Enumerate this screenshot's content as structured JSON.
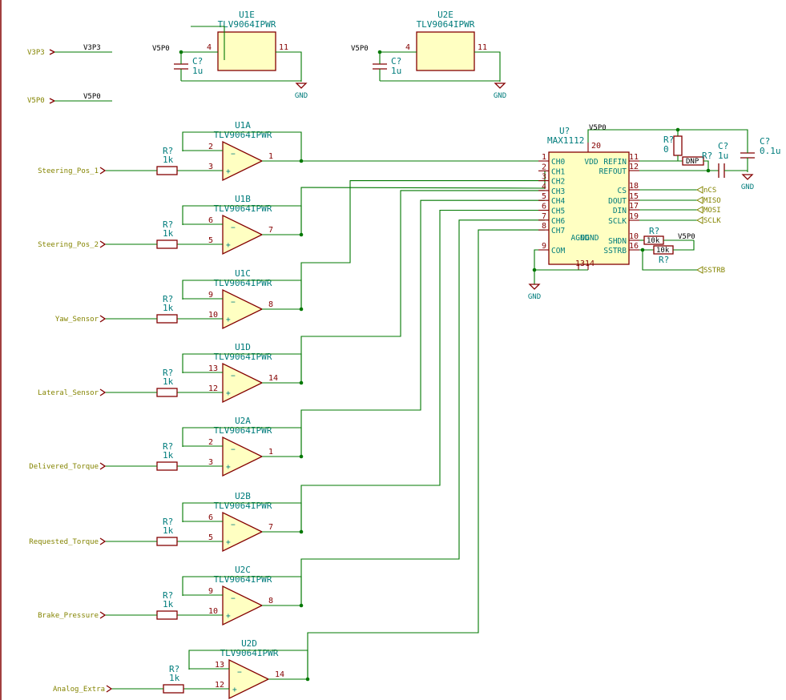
{
  "colors": {
    "wire": "#007800",
    "component": "#840000",
    "text": "#007c7c",
    "global_label": "#848400",
    "ic_fill": "#ffffc2"
  },
  "power": {
    "supply_label": "V5P0",
    "ground_label": "GND"
  },
  "top_labels": {
    "v3p3_port": "V3P3",
    "v3p3_net": "V3P3",
    "v5p0_port": "V5P0",
    "v5p0_net": "V5P0"
  },
  "supply_units": [
    {
      "ref": "U1E",
      "value": "TLV9064IPWR",
      "pin_vplus": "4",
      "pin_vminus": "11",
      "cap_ref": "C?",
      "cap_value": "1u",
      "net": "V5P0",
      "gnd": "GND"
    },
    {
      "ref": "U2E",
      "value": "TLV9064IPWR",
      "pin_vplus": "4",
      "pin_vminus": "11",
      "cap_ref": "C?",
      "cap_value": "1u",
      "net": "V5P0",
      "gnd": "GND"
    }
  ],
  "buffers": [
    {
      "ref": "U1A",
      "value": "TLV9064IPWR",
      "pin_inv": "2",
      "pin_noninv": "3",
      "pin_out": "1",
      "res_ref": "R?",
      "res_value": "1k",
      "input": "Steering_Pos_1"
    },
    {
      "ref": "U1B",
      "value": "TLV9064IPWR",
      "pin_inv": "6",
      "pin_noninv": "5",
      "pin_out": "7",
      "res_ref": "R?",
      "res_value": "1k",
      "input": "Steering_Pos_2"
    },
    {
      "ref": "U1C",
      "value": "TLV9064IPWR",
      "pin_inv": "9",
      "pin_noninv": "10",
      "pin_out": "8",
      "res_ref": "R?",
      "res_value": "1k",
      "input": "Yaw_Sensor"
    },
    {
      "ref": "U1D",
      "value": "TLV9064IPWR",
      "pin_inv": "13",
      "pin_noninv": "12",
      "pin_out": "14",
      "res_ref": "R?",
      "res_value": "1k",
      "input": "Lateral_Sensor"
    },
    {
      "ref": "U2A",
      "value": "TLV9064IPWR",
      "pin_inv": "2",
      "pin_noninv": "3",
      "pin_out": "1",
      "res_ref": "R?",
      "res_value": "1k",
      "input": "Delivered_Torque"
    },
    {
      "ref": "U2B",
      "value": "TLV9064IPWR",
      "pin_inv": "6",
      "pin_noninv": "5",
      "pin_out": "7",
      "res_ref": "R?",
      "res_value": "1k",
      "input": "Requested_Torque"
    },
    {
      "ref": "U2C",
      "value": "TLV9064IPWR",
      "pin_inv": "9",
      "pin_noninv": "10",
      "pin_out": "8",
      "res_ref": "R?",
      "res_value": "1k",
      "input": "Brake_Pressure"
    },
    {
      "ref": "U2D",
      "value": "TLV9064IPWR",
      "pin_inv": "13",
      "pin_noninv": "12",
      "pin_out": "14",
      "res_ref": "R?",
      "res_value": "1k",
      "input": "Analog_Extra"
    }
  ],
  "adc": {
    "ref": "U?",
    "value": "MAX1112",
    "left_pins": [
      {
        "num": "1",
        "name": "CH0"
      },
      {
        "num": "2",
        "name": "CH1"
      },
      {
        "num": "3",
        "name": "CH2"
      },
      {
        "num": "4",
        "name": "CH3"
      },
      {
        "num": "5",
        "name": "CH4"
      },
      {
        "num": "6",
        "name": "CH5"
      },
      {
        "num": "7",
        "name": "CH6"
      },
      {
        "num": "8",
        "name": "CH7"
      },
      {
        "num": "9",
        "name": "COM"
      }
    ],
    "right_pins": [
      {
        "num": "11",
        "name": "REFIN"
      },
      {
        "num": "12",
        "name": "REFOUT"
      },
      {
        "num": "18",
        "name": "CS"
      },
      {
        "num": "15",
        "name": "DOUT"
      },
      {
        "num": "17",
        "name": "DIN"
      },
      {
        "num": "19",
        "name": "SCLK"
      },
      {
        "num": "10",
        "name": "SHDN"
      },
      {
        "num": "16",
        "name": "SSTRB"
      }
    ],
    "top_pin": {
      "num": "20",
      "name": "VDD"
    },
    "bottom_pins": [
      {
        "num": "13",
        "name": "AGND"
      },
      {
        "num": "14",
        "name": "DGND"
      }
    ],
    "signals": [
      {
        "name": "nCS"
      },
      {
        "name": "MISO"
      },
      {
        "name": "MOSI"
      },
      {
        "name": "SCLK"
      },
      {
        "name": "SSTRB"
      }
    ],
    "ref_res": {
      "ref": "R?",
      "value": "0"
    },
    "dnp": {
      "ref": "R?",
      "value": "DNP"
    },
    "ref_cap": {
      "ref": "C?",
      "value": "1u"
    },
    "vdd_cap": {
      "ref": "C?",
      "value": "0.1u"
    },
    "shdn_res": {
      "ref": "R?",
      "value": "10k"
    },
    "sstrb_res": {
      "ref": "R?",
      "value": "10k"
    },
    "supply": "V5P0",
    "gnd": "GND"
  }
}
